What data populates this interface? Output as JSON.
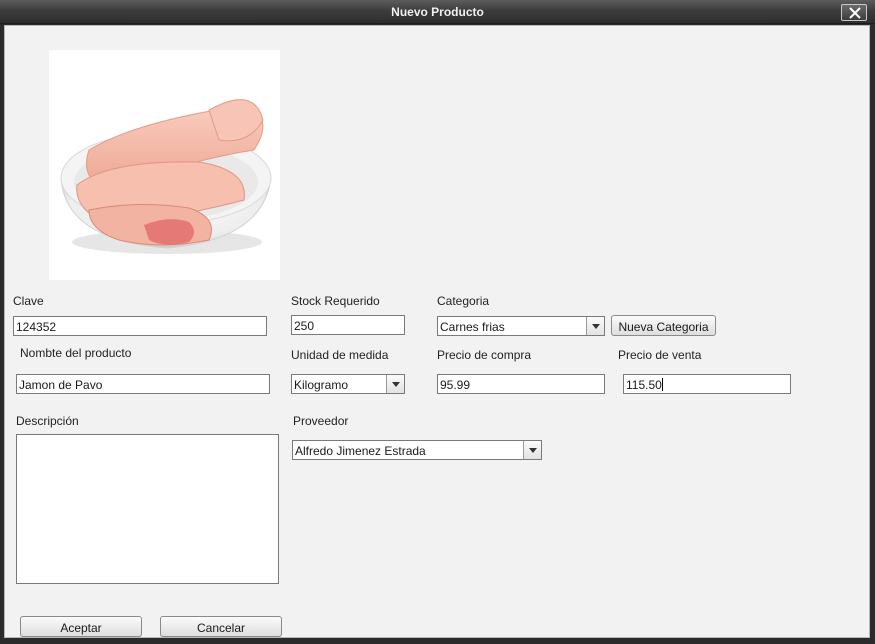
{
  "window": {
    "title": "Nuevo Producto"
  },
  "image": {
    "description": "ham-slices-bowl-photo"
  },
  "form": {
    "clave": {
      "label": "Clave",
      "value": "124352"
    },
    "stock": {
      "label": "Stock Requerido",
      "value": "250"
    },
    "categoria": {
      "label": "Categoria",
      "value": "Carnes frias"
    },
    "nueva_categoria": {
      "label": "Nueva Categoria"
    },
    "nombre": {
      "label": "Nombte del producto",
      "value": "Jamon de Pavo"
    },
    "unidad": {
      "label": "Unidad de medida",
      "value": "Kilogramo"
    },
    "precio_compra": {
      "label": "Precio de compra",
      "value": "95.99"
    },
    "precio_venta": {
      "label": "Precio de venta",
      "value": "115.50"
    },
    "descripcion": {
      "label": "Descripción",
      "value": ""
    },
    "proveedor": {
      "label": "Proveedor",
      "value": "Alfredo Jimenez Estrada"
    }
  },
  "buttons": {
    "aceptar": "Aceptar",
    "cancelar": "Cancelar"
  },
  "colors": {
    "titlebar": "#3a3a3a",
    "panel": "#f2f2f2",
    "field_border": "#7a7a7a"
  }
}
